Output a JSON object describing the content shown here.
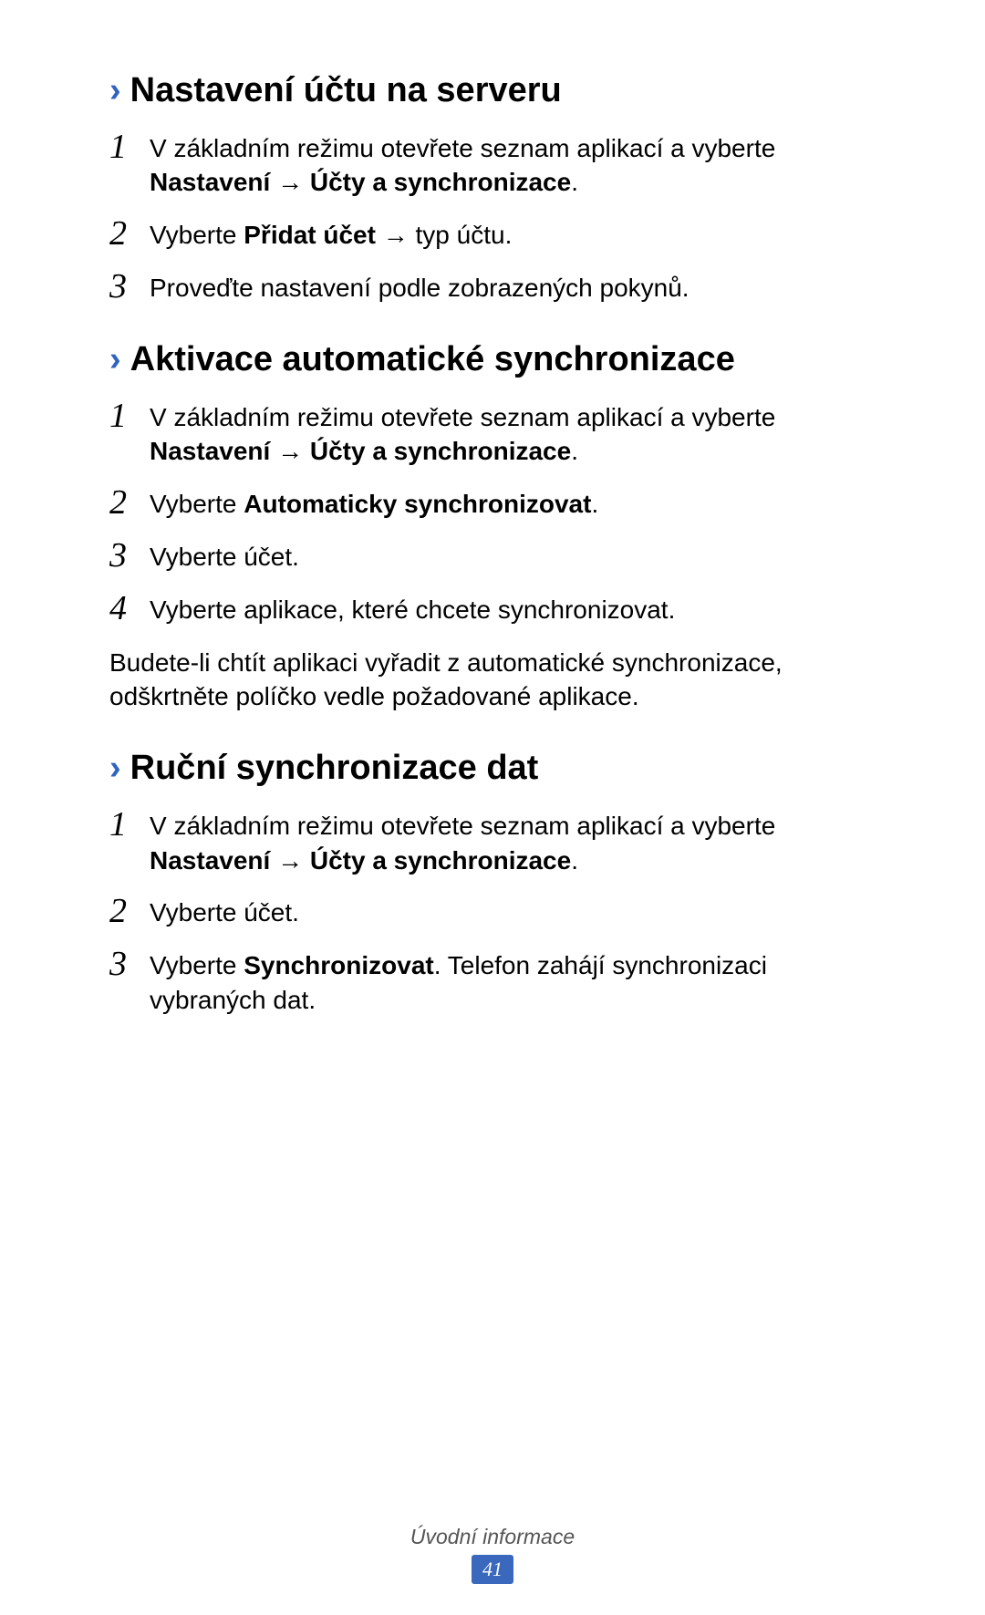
{
  "sections": [
    {
      "chevron": "›",
      "heading": "Nastavení účtu na serveru",
      "steps": [
        {
          "num": "1",
          "parts": [
            {
              "text": "V základním režimu otevřete seznam aplikací a vyberte ",
              "bold": false
            },
            {
              "text": "Nastavení",
              "bold": true
            },
            {
              "text": " → ",
              "bold": false
            },
            {
              "text": "Účty a synchronizace",
              "bold": true
            },
            {
              "text": ".",
              "bold": false
            }
          ]
        },
        {
          "num": "2",
          "parts": [
            {
              "text": "Vyberte ",
              "bold": false
            },
            {
              "text": "Přidat účet",
              "bold": true
            },
            {
              "text": " → typ účtu.",
              "bold": false
            }
          ]
        },
        {
          "num": "3",
          "parts": [
            {
              "text": "Proveďte nastavení podle zobrazených pokynů.",
              "bold": false
            }
          ]
        }
      ]
    },
    {
      "chevron": "›",
      "heading": "Aktivace automatické synchronizace",
      "steps": [
        {
          "num": "1",
          "parts": [
            {
              "text": "V základním režimu otevřete seznam aplikací a vyberte ",
              "bold": false
            },
            {
              "text": "Nastavení",
              "bold": true
            },
            {
              "text": " → ",
              "bold": false
            },
            {
              "text": "Účty a synchronizace",
              "bold": true
            },
            {
              "text": ".",
              "bold": false
            }
          ]
        },
        {
          "num": "2",
          "parts": [
            {
              "text": "Vyberte ",
              "bold": false
            },
            {
              "text": "Automaticky synchronizovat",
              "bold": true
            },
            {
              "text": ".",
              "bold": false
            }
          ]
        },
        {
          "num": "3",
          "parts": [
            {
              "text": "Vyberte účet.",
              "bold": false
            }
          ]
        },
        {
          "num": "4",
          "parts": [
            {
              "text": "Vyberte aplikace, které chcete synchronizovat.",
              "bold": false
            }
          ]
        }
      ],
      "paragraph": "Budete-li chtít aplikaci vyřadit z automatické synchronizace, odškrtněte políčko vedle požadované aplikace."
    },
    {
      "chevron": "›",
      "heading": "Ruční synchronizace dat",
      "steps": [
        {
          "num": "1",
          "parts": [
            {
              "text": "V základním režimu otevřete seznam aplikací a vyberte ",
              "bold": false
            },
            {
              "text": "Nastavení",
              "bold": true
            },
            {
              "text": " → ",
              "bold": false
            },
            {
              "text": "Účty a synchronizace",
              "bold": true
            },
            {
              "text": ".",
              "bold": false
            }
          ]
        },
        {
          "num": "2",
          "parts": [
            {
              "text": "Vyberte účet.",
              "bold": false
            }
          ]
        },
        {
          "num": "3",
          "parts": [
            {
              "text": "Vyberte ",
              "bold": false
            },
            {
              "text": "Synchronizovat",
              "bold": true
            },
            {
              "text": ". Telefon zahájí synchronizaci vybraných dat.",
              "bold": false
            }
          ]
        }
      ]
    }
  ],
  "footer": {
    "breadcrumb": "Úvodní informace",
    "page_number": "41"
  }
}
